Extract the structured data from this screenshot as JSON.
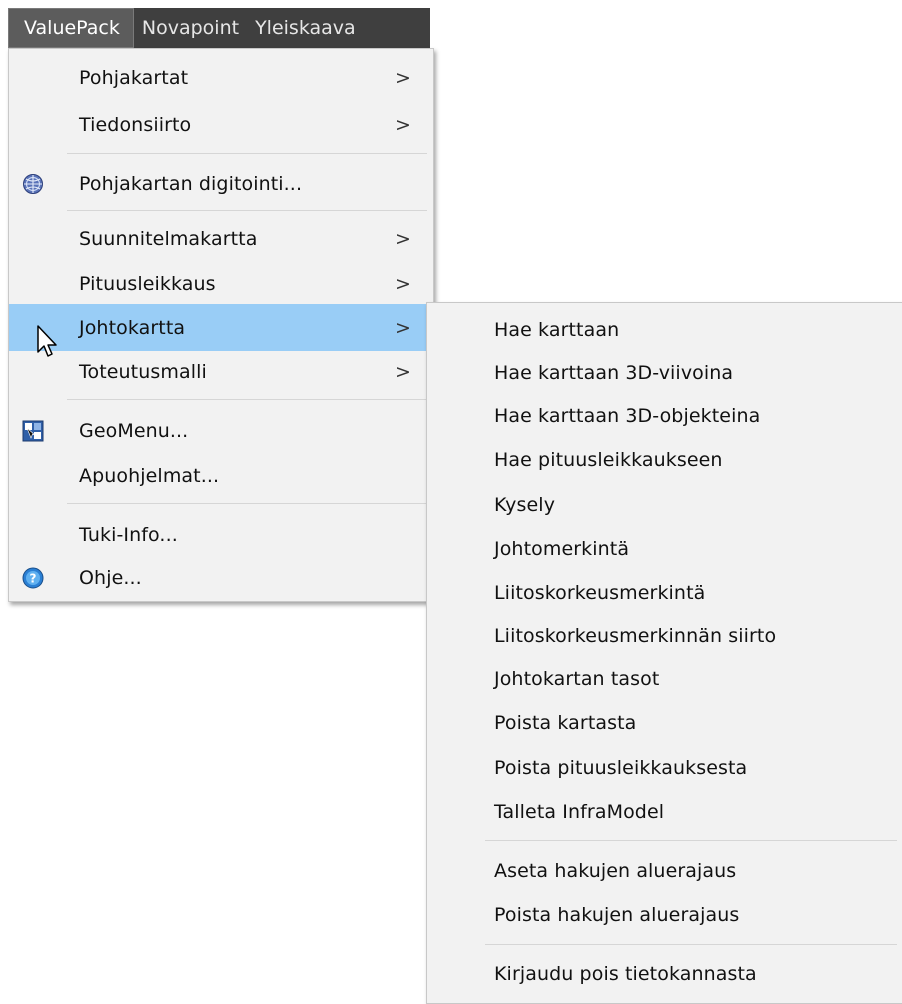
{
  "menubar": {
    "items": [
      {
        "label": "ValuePack"
      },
      {
        "label": "Novapoint"
      },
      {
        "label": "Yleiskaava"
      }
    ]
  },
  "main_menu": {
    "items": [
      {
        "label": "Pohjakartat",
        "submenu": true
      },
      {
        "label": "Tiedonsiirto",
        "submenu": true
      },
      {
        "label": "Pohjakartan digitointi...",
        "icon": "globe-icon"
      },
      {
        "label": "Suunnitelmakartta",
        "submenu": true
      },
      {
        "label": "Pituusleikkaus",
        "submenu": true
      },
      {
        "label": "Johtokartta",
        "submenu": true,
        "highlighted": true
      },
      {
        "label": "Toteutusmalli",
        "submenu": true
      },
      {
        "label": "GeoMenu...",
        "icon": "geomenu-icon"
      },
      {
        "label": "Apuohjelmat..."
      },
      {
        "label": "Tuki-Info..."
      },
      {
        "label": "Ohje...",
        "icon": "help-icon"
      }
    ],
    "arrow_glyph": ">"
  },
  "sub_menu": {
    "items": [
      {
        "label": "Hae karttaan"
      },
      {
        "label": "Hae karttaan 3D-viivoina"
      },
      {
        "label": "Hae karttaan 3D-objekteina"
      },
      {
        "label": "Hae pituusleikkaukseen"
      },
      {
        "label": "Kysely"
      },
      {
        "label": "Johtomerkintä"
      },
      {
        "label": "Liitoskorkeusmerkintä"
      },
      {
        "label": "Liitoskorkeusmerkinnän siirto"
      },
      {
        "label": "Johtokartan tasot"
      },
      {
        "label": "Poista kartasta"
      },
      {
        "label": "Poista pituusleikkauksesta"
      },
      {
        "label": "Talleta InfraModel"
      },
      {
        "label": "Aseta hakujen aluerajaus"
      },
      {
        "label": "Poista hakujen aluerajaus"
      },
      {
        "label": "Kirjaudu pois tietokannasta"
      }
    ]
  },
  "colors": {
    "menubar_bg": "#3f3f3f",
    "menu_bg": "#f2f2f2",
    "highlight": "#99cdf6"
  }
}
